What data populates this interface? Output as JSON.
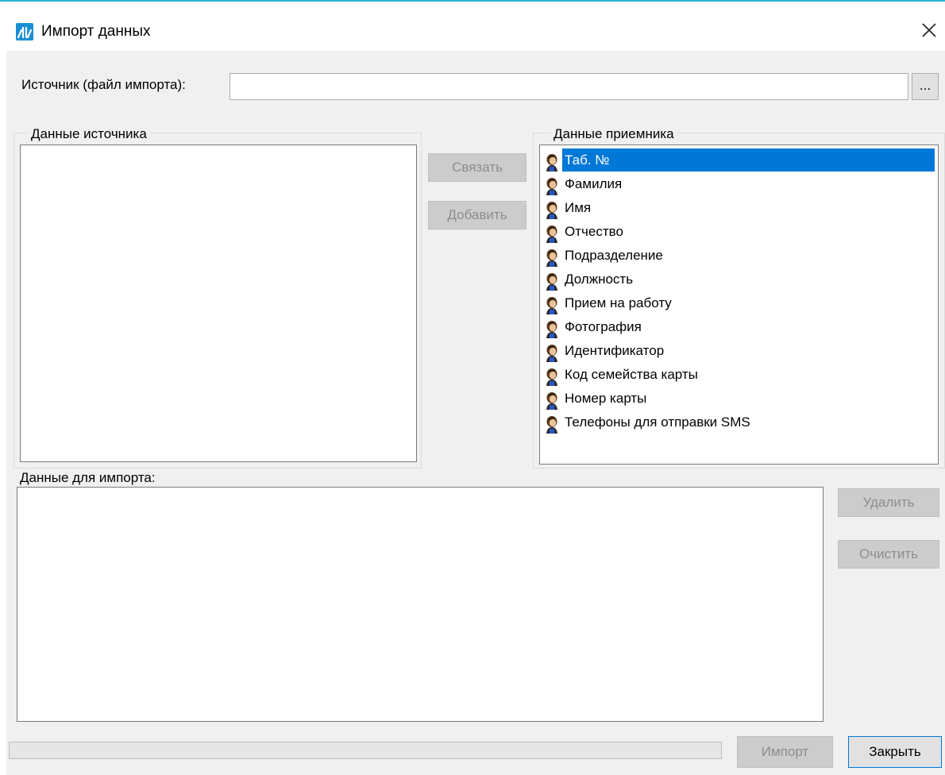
{
  "window": {
    "title": "Импорт данных",
    "accent_color": "#2bb5d6",
    "app_icon": "app-logo-icon",
    "close_icon": "close-icon"
  },
  "source": {
    "label": "Источник (файл импорта):",
    "value": "",
    "placeholder": "",
    "browse_label": "..."
  },
  "source_data": {
    "title": "Данные источника",
    "items": []
  },
  "middle_buttons": {
    "link_label": "Связать",
    "add_label": "Добавить"
  },
  "target_data": {
    "title": "Данные приемника",
    "item_icon": "person-icon",
    "selected_index": 0,
    "selection_color": "#0078d7",
    "items": [
      {
        "label": "Таб. №"
      },
      {
        "label": "Фамилия"
      },
      {
        "label": "Имя"
      },
      {
        "label": "Отчество"
      },
      {
        "label": "Подразделение"
      },
      {
        "label": "Должность"
      },
      {
        "label": "Прием на работу"
      },
      {
        "label": "Фотография"
      },
      {
        "label": "Идентификатор"
      },
      {
        "label": "Код семейства карты"
      },
      {
        "label": "Номер карты"
      },
      {
        "label": "Телефоны для отправки SMS"
      }
    ]
  },
  "import_data": {
    "label": "Данные для импорта:",
    "items": []
  },
  "side_buttons": {
    "delete_label": "Удалить",
    "clear_label": "Очистить"
  },
  "footer": {
    "progress": 0,
    "import_label": "Импорт",
    "close_label": "Закрыть"
  }
}
